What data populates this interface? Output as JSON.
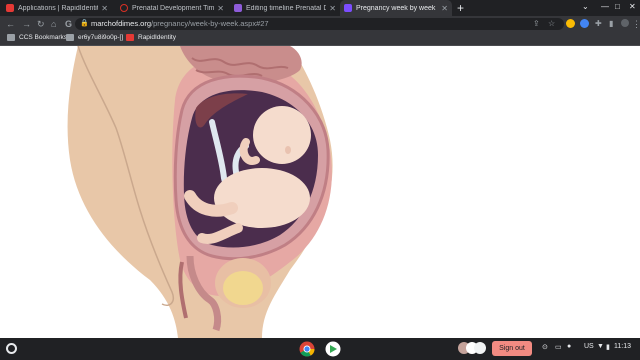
{
  "browser": {
    "tabs": [
      {
        "title": "Applications | RapidIdentity",
        "favicon_color": "#e53935",
        "active": false
      },
      {
        "title": "Prenatal Development Timeline",
        "favicon_color": "#d93025",
        "active": false
      },
      {
        "title": "Editing timeline Prenatal Develo",
        "favicon_color": "#8e5cd9",
        "active": false
      },
      {
        "title": "Pregnancy week by week",
        "favicon_color": "#7c4dff",
        "active": true
      }
    ],
    "url_domain": "marchofdimes.org",
    "url_path": "/pregnancy/week-by-week.aspx#27",
    "bookmarks": [
      {
        "label": "CCS Bookmarks",
        "icon": "folder-icon"
      },
      {
        "label": "er6y7u8i9o0p-[]",
        "icon": "folder-icon"
      },
      {
        "label": "RapidIdentity",
        "icon": "rapididentity-icon"
      }
    ]
  },
  "shelf": {
    "sign_out_label": "Sign out",
    "locale": "US",
    "time": "11:13"
  },
  "icons": {
    "chrome": "chrome-icon",
    "play_store": "play-store-icon"
  }
}
